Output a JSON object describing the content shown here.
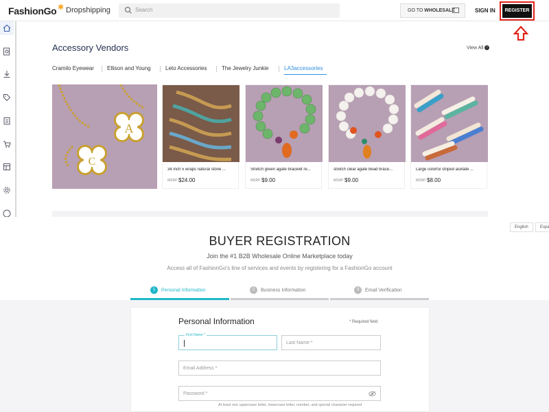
{
  "header": {
    "logo_fashion": "FashionGo",
    "logo_sub": "Dropshipping",
    "search_placeholder": "Search",
    "wholesale_prefix": "GO TO ",
    "wholesale_label": "WHOLESALE",
    "signin_label": "SIGN IN",
    "register_label": "REGISTER",
    "highlight_color": "#e2231a"
  },
  "sidebar": {
    "icons": [
      "home-icon",
      "search-doc-icon",
      "download-icon",
      "tag-icon",
      "clipboard-icon",
      "cart-icon",
      "layout-icon",
      "gear-icon",
      "dollar-icon"
    ]
  },
  "vendors": {
    "title": "Accessory Vendors",
    "view_all": "View All",
    "tabs": [
      "Cramilo Eyewear",
      "Ellison and Young",
      "Leto Accessories",
      "The Jewelry Junkie",
      "LA3accessories"
    ],
    "active_tab": "LA3accessories",
    "accent_color": "#2d8ee0",
    "products": [
      {
        "title": "34 inch 5 wraps natural stone ...",
        "msrp": "MSRP",
        "price": "$24.00"
      },
      {
        "title": "Stretch green agate bracelet re...",
        "msrp": "MSRP",
        "price": "$9.00"
      },
      {
        "title": "stretch clear agate bead brace...",
        "msrp": "MSRP",
        "price": "$9.00"
      },
      {
        "title": "Large colorful striped acetate ...",
        "msrp": "MSRP",
        "price": "$8.00"
      }
    ]
  },
  "registration": {
    "languages": [
      "English",
      "Espa"
    ],
    "title": "BUYER REGISTRATION",
    "subtitle": "Join the #1 B2B Wholesale Online Marketplace today",
    "description": "Access all of FashionGo's line of services and events by registering for a FashionGo account",
    "steps": [
      {
        "num": "1",
        "label": "Personal Information"
      },
      {
        "num": "2",
        "label": "Business Information"
      },
      {
        "num": "3",
        "label": "Email Verification"
      }
    ],
    "active_step": 1,
    "accent_color": "#1fb7c9",
    "form": {
      "title": "Personal Information",
      "required_note": "* Required field",
      "first_name_label": "First Name *",
      "last_name_ph": "Last Name *",
      "email_ph": "Email Address *",
      "password_ph": "Password *",
      "password_hint": "At least one uppercase letter, lowercase letter, number, and special character required"
    }
  }
}
